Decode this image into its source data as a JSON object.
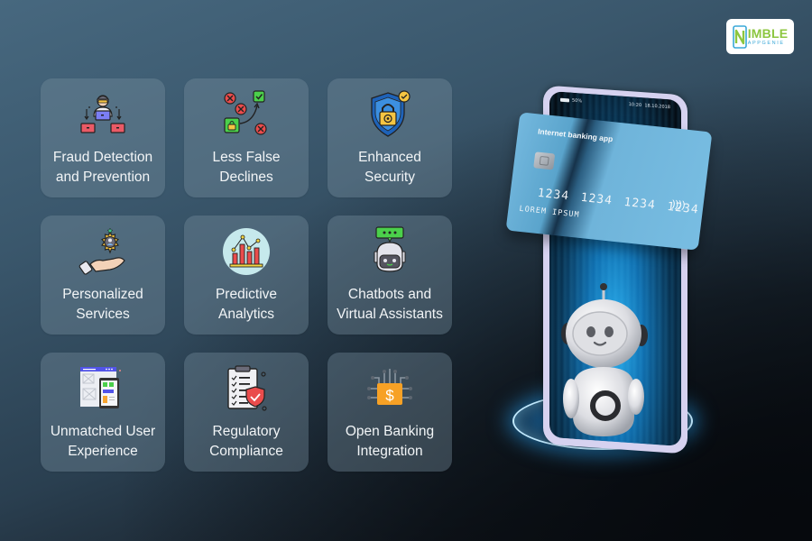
{
  "brand": {
    "logo_primary": "IMBLE",
    "logo_secondary": "APPGENIE",
    "logo_primary_color": "#8cc63f",
    "logo_secondary_color": "#3aa8d8"
  },
  "features": [
    {
      "label": "Fraud Detection\nand Prevention",
      "icon": "hacker-laptop-icon"
    },
    {
      "label": "Less False\nDeclines",
      "icon": "approve-decline-icon"
    },
    {
      "label": "Enhanced\nSecurity",
      "icon": "shield-lock-icon"
    },
    {
      "label": "Personalized\nServices",
      "icon": "hand-gear-user-icon"
    },
    {
      "label": "Predictive\nAnalytics",
      "icon": "bar-line-chart-icon"
    },
    {
      "label": "Chatbots and\nVirtual Assistants",
      "icon": "chatbot-icon"
    },
    {
      "label": "Unmatched User\nExperience",
      "icon": "ui-wireframe-icon"
    },
    {
      "label": "Regulatory\nCompliance",
      "icon": "clipboard-shield-icon"
    },
    {
      "label": "Open Banking\nIntegration",
      "icon": "dollar-circuit-icon"
    }
  ],
  "illustration": {
    "phone_status_left": "50%",
    "phone_status_time": "10:20",
    "phone_status_date": "18.10.2018",
    "card_title": "Internet banking app",
    "card_number": "1234 1234 1234 1234",
    "card_holder": "LOREM IPSUM",
    "contactless_symbol": "))))"
  }
}
